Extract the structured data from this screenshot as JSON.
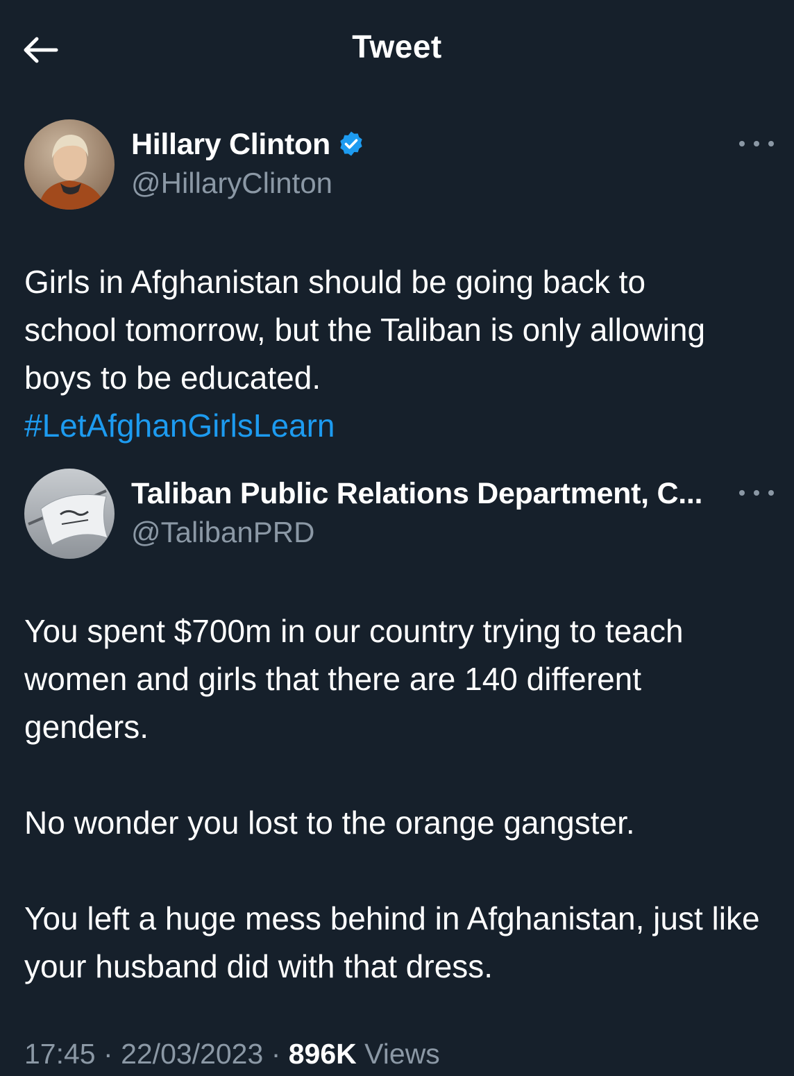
{
  "header": {
    "title": "Tweet",
    "back_icon": "arrow-left-icon"
  },
  "tweet": {
    "author": {
      "display_name": "Hillary Clinton",
      "handle": "@HillaryClinton",
      "verified": true
    },
    "text_lines": [
      "Girls in Afghanistan should be going back to school tomorrow, but the Taliban is only allowing boys to be educated."
    ],
    "hashtag": "#LetAfghanGirlsLearn"
  },
  "quoted_tweet": {
    "author": {
      "display_name": "Taliban Public Relations Department, C...",
      "handle": "@TalibanPRD"
    },
    "paragraphs": [
      "You spent $700m in our country trying to teach women and girls that there are 140 different genders.",
      "No wonder you lost to the orange gangster.",
      "You left a huge mess behind in Afghanistan, just like your husband did with that dress."
    ]
  },
  "meta": {
    "time": "17:45",
    "separator": "·",
    "date": "22/03/2023",
    "views_count": "896K",
    "views_label": "Views"
  },
  "colors": {
    "background": "#16202b",
    "text": "#ffffff",
    "secondary": "#8b98a5",
    "accent": "#1d9bf0"
  }
}
